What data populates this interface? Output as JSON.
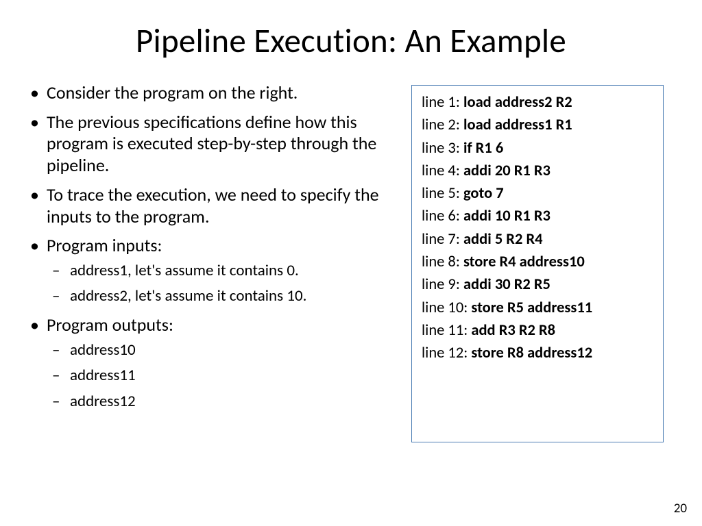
{
  "title": "Pipeline Execution: An Example",
  "bullets": {
    "b0": "Consider the program on the right.",
    "b1": "The previous specifications define how this program is executed step-by-step through the pipeline.",
    "b2": "To trace the execution, we need to specify the inputs to the program.",
    "b3": "Program inputs:",
    "b3s0": "address1, let's assume it contains 0.",
    "b3s1": "address2, let's assume it contains 10.",
    "b4": "Program outputs:",
    "b4s0": "address10",
    "b4s1": "address11",
    "b4s2": "address12"
  },
  "program": {
    "l1p": "line 1: ",
    "l1c": "load address2 R2",
    "l2p": "line 2: ",
    "l2c": "load address1 R1",
    "l3p": "line 3: ",
    "l3c": "if R1 6",
    "l4p": "line 4: ",
    "l4c": "addi 20 R1 R3",
    "l5p": "line 5: ",
    "l5c": "goto 7",
    "l6p": "line 6: ",
    "l6c": "addi 10 R1 R3",
    "l7p": "line 7: ",
    "l7c": "addi 5 R2 R4",
    "l8p": "line 8: ",
    "l8c": "store R4 address10",
    "l9p": "line 9: ",
    "l9c": "addi 30 R2 R5",
    "l10p": "line 10: ",
    "l10c": "store R5 address11",
    "l11p": "line 11: ",
    "l11c": "add R3 R2 R8",
    "l12p": "line 12: ",
    "l12c": "store R8 address12"
  },
  "page_number": "20"
}
